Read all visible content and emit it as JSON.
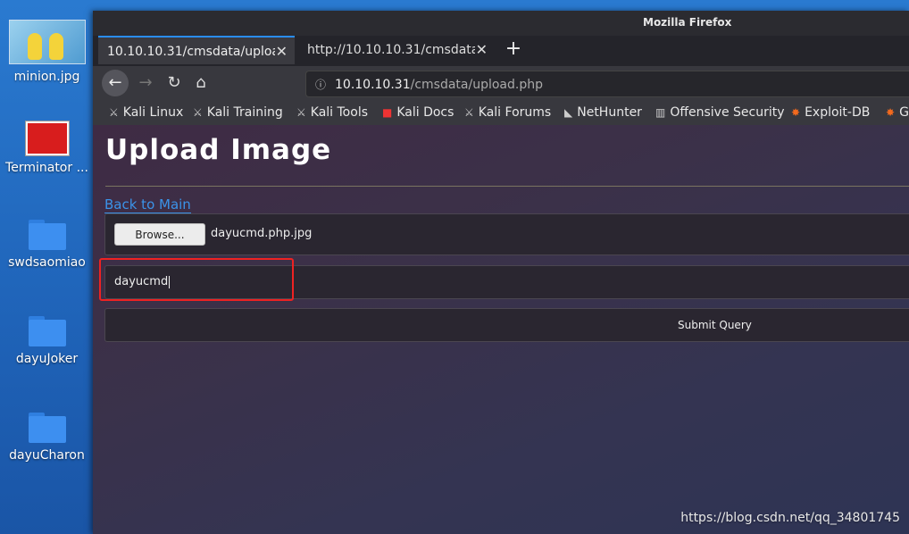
{
  "desktop": {
    "icons": [
      {
        "label": "minion.jpg"
      },
      {
        "label": "Terminator ..."
      },
      {
        "label": "swdsaomiao"
      },
      {
        "label": "dayuJoker"
      },
      {
        "label": "dayuCharon"
      }
    ]
  },
  "window": {
    "title": "Mozilla Firefox",
    "tabs": [
      {
        "label": "10.10.10.31/cmsdata/upload",
        "active": true
      },
      {
        "label": "http://10.10.10.31/cmsdata/u",
        "active": false
      }
    ],
    "url": {
      "host": "10.10.10.31",
      "path": "/cmsdata/upload.php"
    },
    "bookmarks": [
      "Kali Linux",
      "Kali Training",
      "Kali Tools",
      "Kali Docs",
      "Kali Forums",
      "NetHunter",
      "Offensive Security",
      "Exploit-DB",
      "G"
    ]
  },
  "page": {
    "title": "Upload Image",
    "back_link": "Back to Main",
    "browse_label": "Browse...",
    "file_name": "dayucmd.php.jpg",
    "text_value": "dayucmd",
    "submit_label": "Submit Query"
  },
  "watermark": "https://blog.csdn.net/qq_34801745",
  "colors": {
    "highlight": "#e22222",
    "link": "#3b93e8",
    "tab_accent": "#2a8df3"
  }
}
